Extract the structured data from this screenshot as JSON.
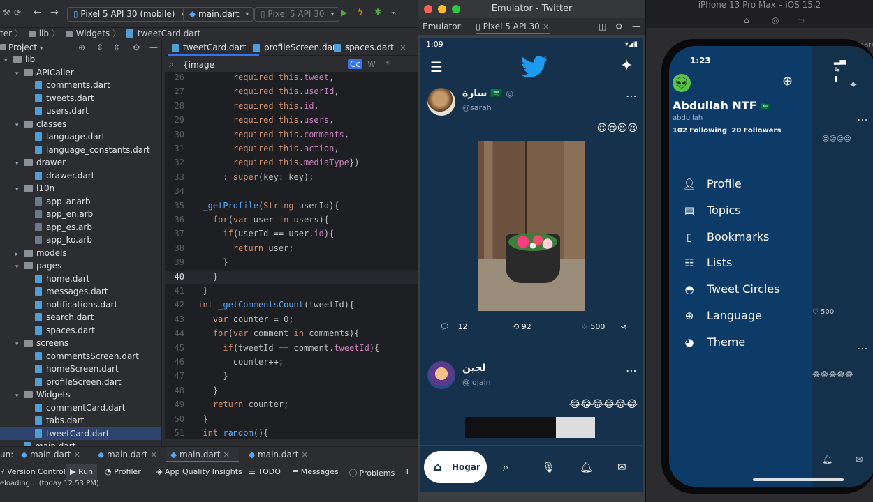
{
  "ide": {
    "device_selector": "Pixel 5 API 30 (mobile)",
    "config_selector": "main.dart",
    "second_device": "Pixel 5 API 30",
    "breadcrumb": [
      "ter",
      "lib",
      "Widgets",
      "tweetCard.dart"
    ],
    "project_header": "Project",
    "tree": [
      {
        "label": "lib",
        "type": "folder",
        "indent": 0
      },
      {
        "label": "APICaller",
        "type": "folder",
        "indent": 1
      },
      {
        "label": "comments.dart",
        "type": "file",
        "indent": 2
      },
      {
        "label": "tweets.dart",
        "type": "file",
        "indent": 2
      },
      {
        "label": "users.dart",
        "type": "file",
        "indent": 2
      },
      {
        "label": "classes",
        "type": "folder",
        "indent": 1
      },
      {
        "label": "language.dart",
        "type": "file",
        "indent": 2
      },
      {
        "label": "language_constants.dart",
        "type": "file",
        "indent": 2
      },
      {
        "label": "drawer",
        "type": "folder",
        "indent": 1
      },
      {
        "label": "drawer.dart",
        "type": "file",
        "indent": 2
      },
      {
        "label": "l10n",
        "type": "folder",
        "indent": 1
      },
      {
        "label": "app_ar.arb",
        "type": "arb",
        "indent": 2
      },
      {
        "label": "app_en.arb",
        "type": "arb",
        "indent": 2
      },
      {
        "label": "app_es.arb",
        "type": "arb",
        "indent": 2
      },
      {
        "label": "app_ko.arb",
        "type": "arb",
        "indent": 2
      },
      {
        "label": "models",
        "type": "folder-closed",
        "indent": 1
      },
      {
        "label": "pages",
        "type": "folder",
        "indent": 1
      },
      {
        "label": "home.dart",
        "type": "file",
        "indent": 2
      },
      {
        "label": "messages.dart",
        "type": "file",
        "indent": 2
      },
      {
        "label": "notifications.dart",
        "type": "file",
        "indent": 2
      },
      {
        "label": "search.dart",
        "type": "file",
        "indent": 2
      },
      {
        "label": "spaces.dart",
        "type": "file",
        "indent": 2
      },
      {
        "label": "screens",
        "type": "folder",
        "indent": 1
      },
      {
        "label": "commentsScreen.dart",
        "type": "file",
        "indent": 2
      },
      {
        "label": "homeScreen.dart",
        "type": "file",
        "indent": 2
      },
      {
        "label": "profileScreen.dart",
        "type": "file",
        "indent": 2
      },
      {
        "label": "Widgets",
        "type": "folder",
        "indent": 1
      },
      {
        "label": "commentCard.dart",
        "type": "file",
        "indent": 2
      },
      {
        "label": "tabs.dart",
        "type": "file",
        "indent": 2
      },
      {
        "label": "tweetCard.dart",
        "type": "file",
        "indent": 2,
        "selected": true
      },
      {
        "label": "main.dart",
        "type": "file",
        "indent": 1
      }
    ],
    "editor_tabs": [
      "tweetCard.dart",
      "profileScreen.dart",
      "spaces.dart"
    ],
    "search_text": "{image",
    "search_flags": [
      "Cc",
      "W",
      "*"
    ],
    "code_lines": [
      {
        "n": "26",
        "t": "        required this.tweet,"
      },
      {
        "n": "27",
        "t": "        required this.userId,"
      },
      {
        "n": "28",
        "t": "        required this.id,"
      },
      {
        "n": "29",
        "t": "        required this.users,"
      },
      {
        "n": "30",
        "t": "        required this.comments,"
      },
      {
        "n": "31",
        "t": "        required this.action,"
      },
      {
        "n": "32",
        "t": "        required this.mediaType})"
      },
      {
        "n": "33",
        "t": "      : super(key: key);"
      },
      {
        "n": "34",
        "t": ""
      },
      {
        "n": "35",
        "t": "  _getProfile(String userId){"
      },
      {
        "n": "36",
        "t": "    for(var user in users){"
      },
      {
        "n": "37",
        "t": "      if(userId == user.id){"
      },
      {
        "n": "38",
        "t": "        return user;"
      },
      {
        "n": "39",
        "t": "      }"
      },
      {
        "n": "40",
        "t": "    }"
      },
      {
        "n": "41",
        "t": "  }"
      },
      {
        "n": "42",
        "t": " int _getCommentsCount(tweetId){"
      },
      {
        "n": "43",
        "t": "    var counter = 0;"
      },
      {
        "n": "44",
        "t": "    for(var comment in comments){"
      },
      {
        "n": "45",
        "t": "      if(tweetId == comment.tweetId){"
      },
      {
        "n": "46",
        "t": "        counter++;"
      },
      {
        "n": "47",
        "t": "      }"
      },
      {
        "n": "48",
        "t": "    }"
      },
      {
        "n": "49",
        "t": "    return counter;"
      },
      {
        "n": "50",
        "t": "  }"
      },
      {
        "n": "51",
        "t": "  int random(){"
      },
      {
        "n": "52",
        "t": ""
      }
    ],
    "run_label": "un:",
    "run_tabs": [
      "main.dart",
      "main.dart",
      "main.dart",
      "main.dart"
    ],
    "tool_tabs": [
      "Version Control",
      "Run",
      "Profiler",
      "App Quality Insights",
      "TODO",
      "Messages",
      "Problems",
      "T"
    ],
    "status_text": "eloading... (today 12:53 PM)"
  },
  "emulator": {
    "window_title": "Emulator - Twitter",
    "label": "Emulator:",
    "device_tab": "Pixel 5 API 30",
    "time": "1:09",
    "tweets": [
      {
        "name": "سارة",
        "flag": "🇸🇦",
        "handle": "@sarah",
        "text": "😍😍😍😍",
        "comments": "12",
        "retweets": "92",
        "likes": "500"
      },
      {
        "name": "لجين",
        "handle": "@lojain",
        "text": "😂😂😂😂😂😂"
      }
    ],
    "nav_home": "Hogar"
  },
  "ios": {
    "title": "iPhone 13 Pro Max – iOS 15.2",
    "time": "1:23",
    "name": "Abdullah NTF",
    "flag": "🇸🇦",
    "handle": "abdullah",
    "following_count": "102",
    "following_label": "Following",
    "followers_count": "20",
    "followers_label": "Followers",
    "menu": [
      {
        "label": "Profile",
        "icon": "person-icon"
      },
      {
        "label": "Topics",
        "icon": "topics-icon"
      },
      {
        "label": "Bookmarks",
        "icon": "bookmark-icon"
      },
      {
        "label": "Lists",
        "icon": "list-icon"
      },
      {
        "label": "Tweet Circles",
        "icon": "circle-icon"
      },
      {
        "label": "Language",
        "icon": "globe-icon"
      },
      {
        "label": "Theme",
        "icon": "palette-icon"
      }
    ],
    "behind_text": "omentsS",
    "behind_likes": "500",
    "behind_emoji1": "😍😍😍😍",
    "behind_emoji2": "😂😂😂😂😂"
  }
}
